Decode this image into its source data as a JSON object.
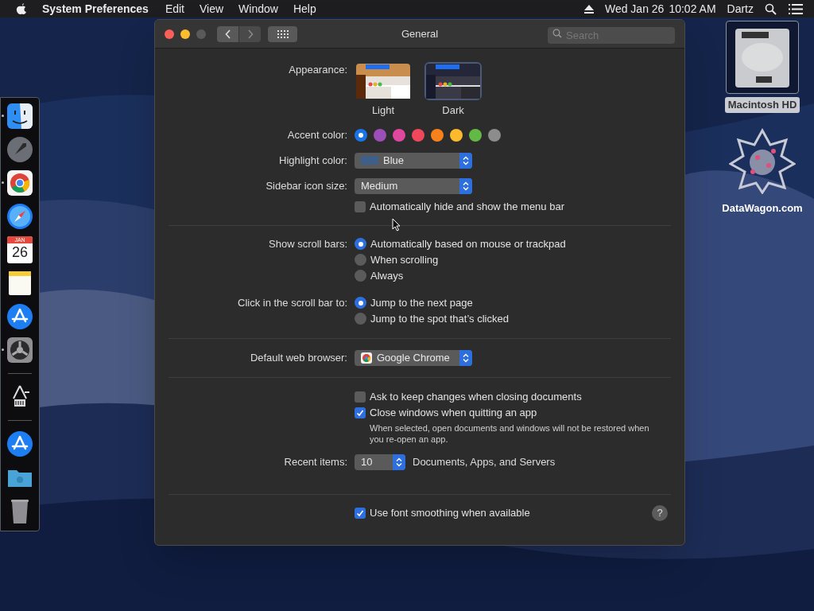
{
  "menubar": {
    "app": "System Preferences",
    "menus": [
      "Edit",
      "View",
      "Window",
      "Help"
    ],
    "date": "Wed Jan 26",
    "time": "10:02 AM",
    "user": "Dartz"
  },
  "window": {
    "title": "General",
    "search_placeholder": "Search"
  },
  "appearance": {
    "label": "Appearance:",
    "options": [
      {
        "label": "Light",
        "kind": "light",
        "selected": false
      },
      {
        "label": "Dark",
        "kind": "dark",
        "selected": true
      }
    ]
  },
  "accent": {
    "label": "Accent color:",
    "colors": [
      {
        "color": "#1a73e8",
        "selected": true
      },
      {
        "color": "#9b4fb7",
        "selected": false
      },
      {
        "color": "#e0479e",
        "selected": false
      },
      {
        "color": "#f0475a",
        "selected": false
      },
      {
        "color": "#f7821b",
        "selected": false
      },
      {
        "color": "#fdba2c",
        "selected": false
      },
      {
        "color": "#62ba46",
        "selected": false
      },
      {
        "color": "#8c8c8c",
        "selected": false
      }
    ]
  },
  "highlight": {
    "label": "Highlight color:",
    "value": "Blue",
    "color": "#3e5f8a"
  },
  "sidebar_icon_size": {
    "label": "Sidebar icon size:",
    "value": "Medium"
  },
  "menu_bar_autohide": {
    "label": "Automatically hide and show the menu bar",
    "checked": false
  },
  "scroll_bars": {
    "label": "Show scroll bars:",
    "options": [
      {
        "label": "Automatically based on mouse or trackpad",
        "selected": true
      },
      {
        "label": "When scrolling",
        "selected": false
      },
      {
        "label": "Always",
        "selected": false
      }
    ]
  },
  "scroll_click": {
    "label": "Click in the scroll bar to:",
    "options": [
      {
        "label": "Jump to the next page",
        "selected": true
      },
      {
        "label": "Jump to the spot that’s clicked",
        "selected": false
      }
    ]
  },
  "browser": {
    "label": "Default web browser:",
    "value": "Google Chrome"
  },
  "ask_keep_changes": {
    "label": "Ask to keep changes when closing documents",
    "checked": false
  },
  "close_windows": {
    "label": "Close windows when quitting an app",
    "checked": true,
    "note": "When selected, open documents and windows will not be restored when you re-open an app."
  },
  "recent_items": {
    "label": "Recent items:",
    "value": "10",
    "suffix": "Documents, Apps, and Servers"
  },
  "font_smoothing": {
    "label": "Use font smoothing when available",
    "checked": true
  },
  "help": "?",
  "dock": [
    {
      "kind": "finder",
      "running": true
    },
    {
      "kind": "launchpad",
      "running": false
    },
    {
      "kind": "chrome",
      "running": true
    },
    {
      "kind": "safari",
      "running": false
    },
    {
      "kind": "calendar",
      "running": false,
      "month": "JAN",
      "day": "26"
    },
    {
      "kind": "notes",
      "running": false
    },
    {
      "kind": "appstore",
      "running": false
    },
    {
      "kind": "settings",
      "running": true
    },
    {
      "kind": "separator"
    },
    {
      "kind": "tool",
      "running": false
    },
    {
      "kind": "separator"
    },
    {
      "kind": "appstore",
      "running": false
    },
    {
      "kind": "folder",
      "running": false
    },
    {
      "kind": "trash",
      "running": false
    }
  ],
  "desktop": [
    {
      "kind": "disk",
      "label": "Macintosh HD",
      "selected": true
    },
    {
      "kind": "web",
      "label": "DataWagon.com",
      "selected": false
    }
  ]
}
